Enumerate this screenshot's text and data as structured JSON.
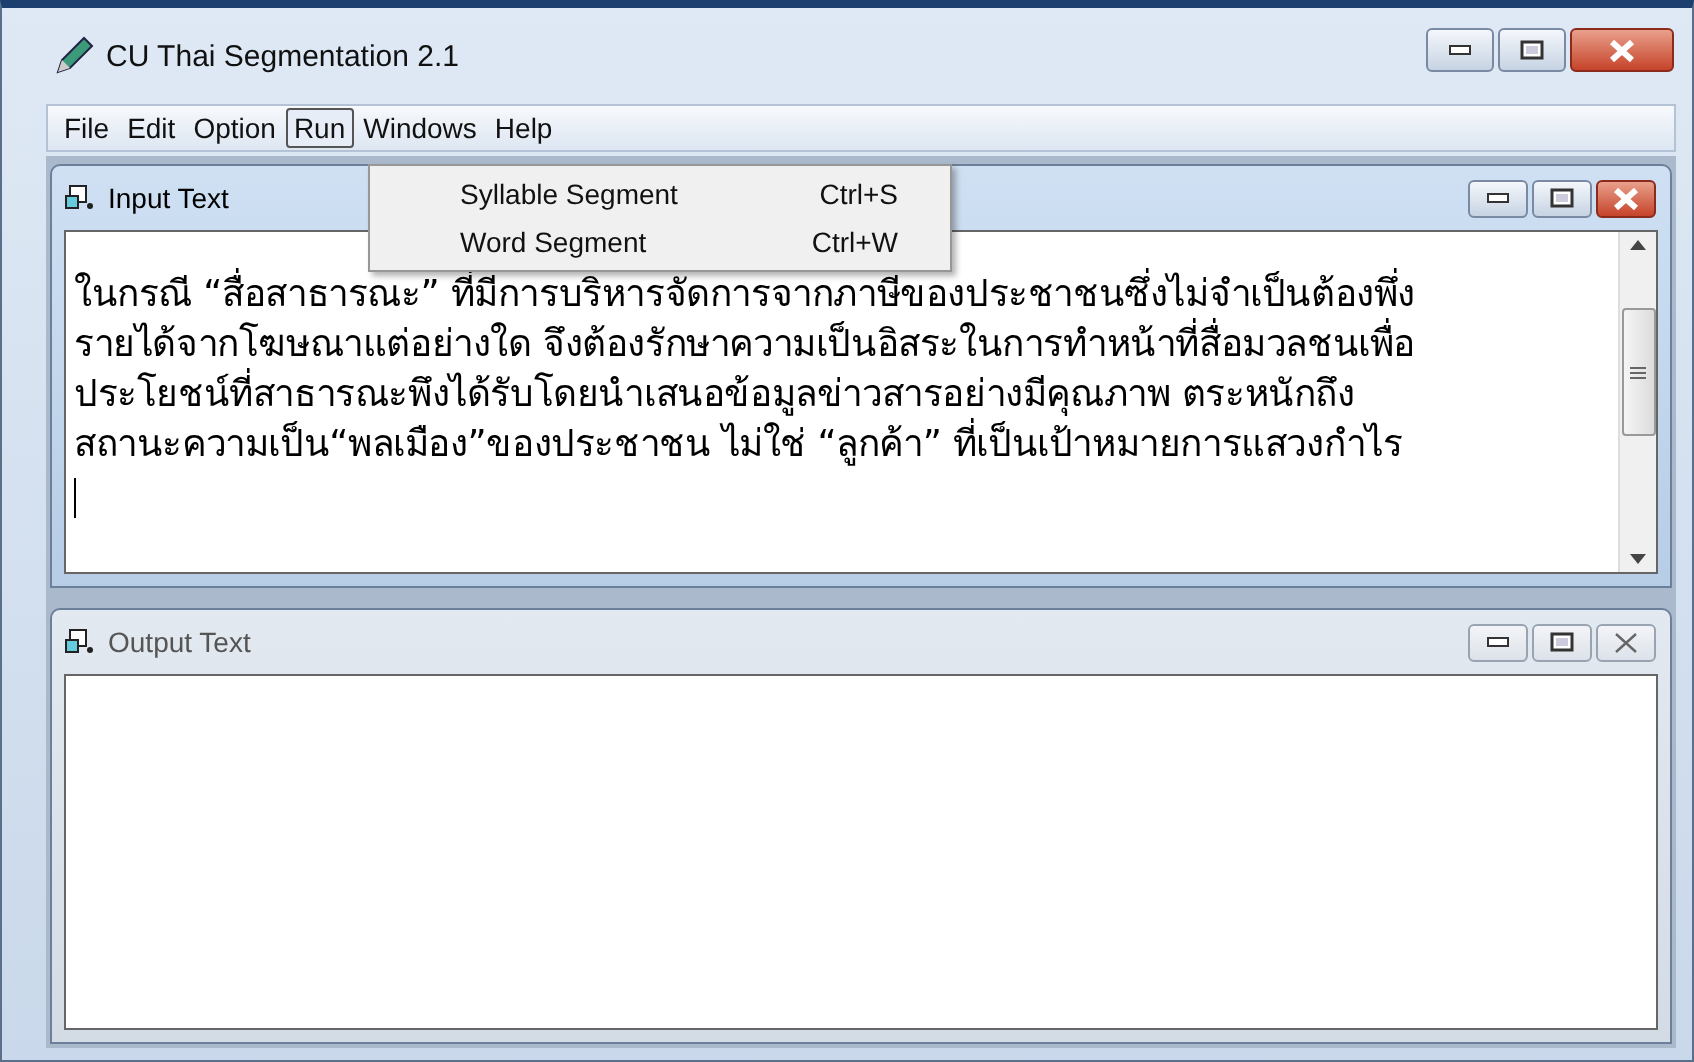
{
  "window": {
    "title": "CU Thai Segmentation 2.1"
  },
  "menu_bar": [
    {
      "label": "File",
      "selected": false
    },
    {
      "label": "Edit",
      "selected": false
    },
    {
      "label": "Option",
      "selected": false
    },
    {
      "label": "Run",
      "selected": true
    },
    {
      "label": "Windows",
      "selected": false
    },
    {
      "label": "Help",
      "selected": false
    }
  ],
  "open_menu": [
    {
      "label": "Syllable Segment",
      "shortcut": "Ctrl+S"
    },
    {
      "label": "Word Segment",
      "shortcut": "Ctrl+W"
    }
  ],
  "child_windows": [
    {
      "title": "Input Text",
      "active": true,
      "lines": [
        "ในกรณี “สื่อสาธารณะ” ที่มีการบริหารจัดการจากภาษีของประชาชนซึ่งไม่จำเป็นต้องพึ่ง",
        "รายได้จากโฆษณาแต่อย่างใด จึงต้องรักษาความเป็นอิสระในการทำหน้าที่สื่อมวลชนเพื่อ",
        "ประโยชน์ที่สาธารณะพึงได้รับโดยนำเสนอข้อมูลข่าวสารอย่างมีคุณภาพ ตระหนักถึง",
        "สถานะความเป็น“พลเมือง”ของประชาชน ไม่ใช่ “ลูกค้า” ที่เป็นเป้าหมายการแสวงกำไร"
      ]
    },
    {
      "title": "Output Text",
      "active": false
    }
  ]
}
